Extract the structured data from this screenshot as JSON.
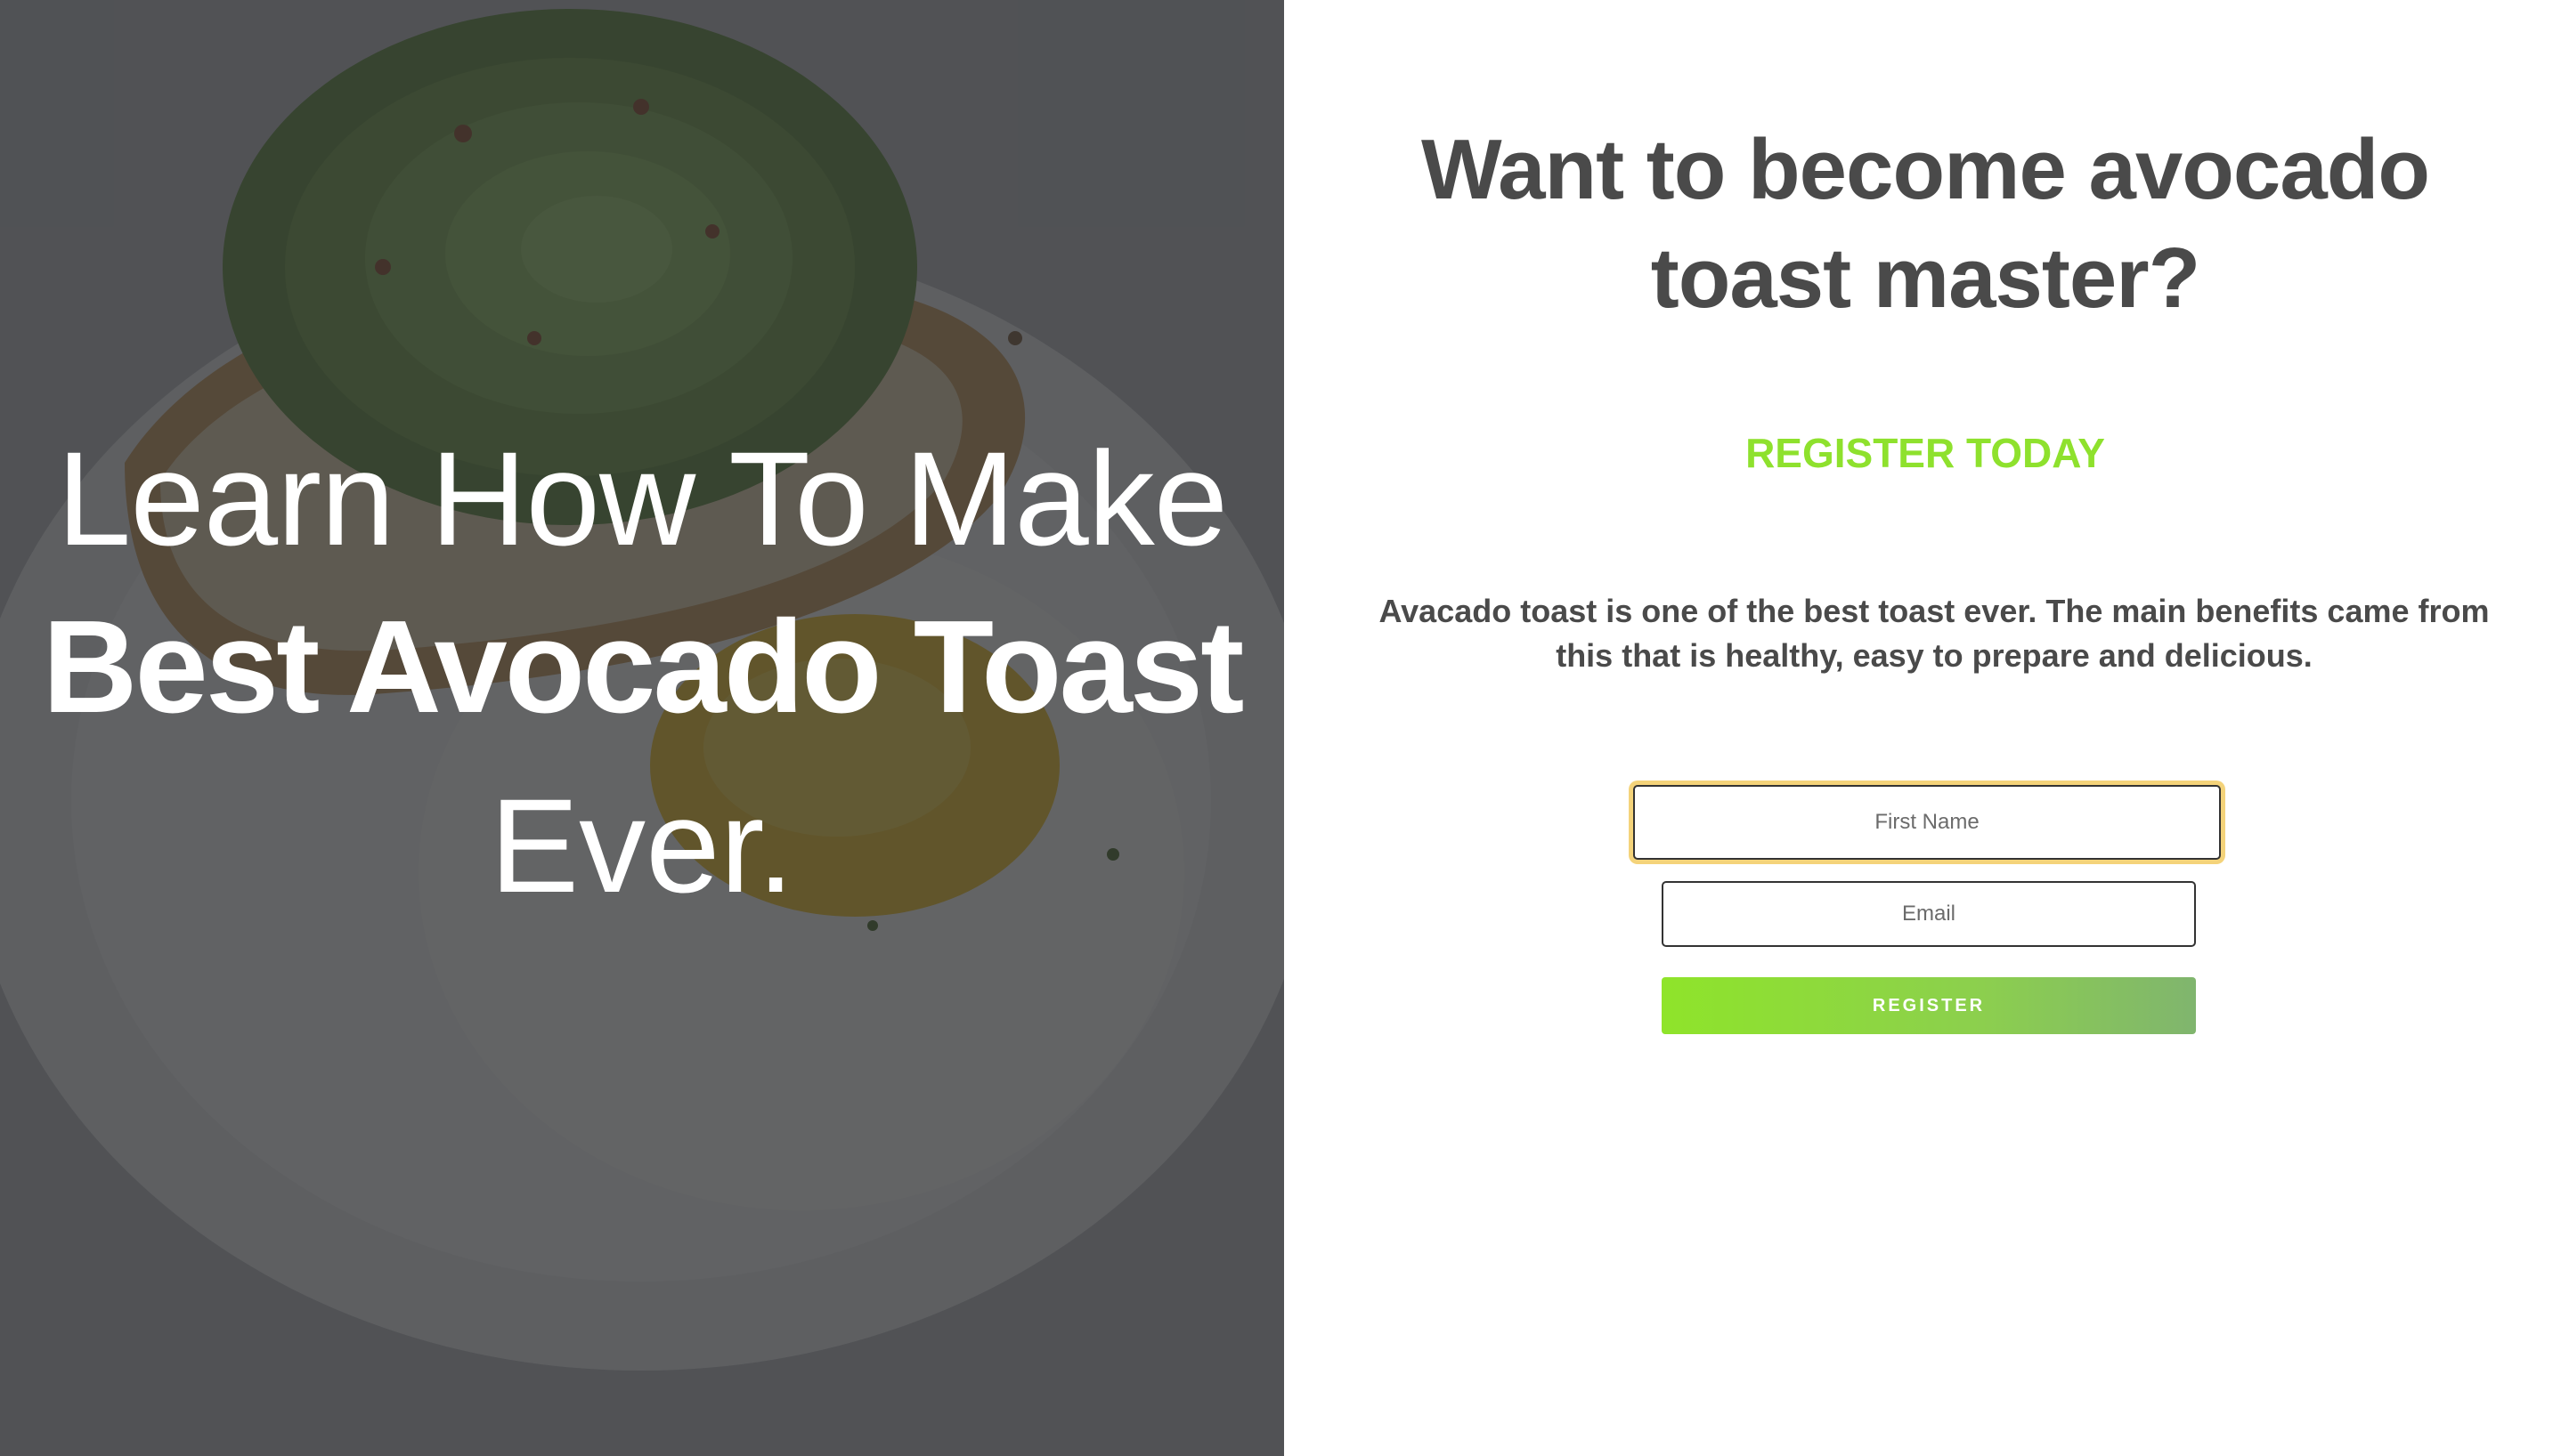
{
  "hero": {
    "line1": "Learn How To Make",
    "line2": "Best Avocado Toast",
    "line3": "Ever."
  },
  "panel": {
    "title": "Want to become avocado toast master?",
    "cta": "REGISTER TODAY",
    "description": "Avacado toast is one of the best toast ever. The main benefits came from this that is healthy, easy to prepare and delicious."
  },
  "form": {
    "first_name_placeholder": "First Name",
    "email_placeholder": "Email",
    "register_label": "REGISTER"
  },
  "colors": {
    "accent_green": "#8ee12d",
    "text_dark": "#4a4a4a",
    "focus_ring": "#f4d37a",
    "overlay": "#28292c"
  },
  "icons": {
    "hero_background": "avocado-toast-photo"
  }
}
